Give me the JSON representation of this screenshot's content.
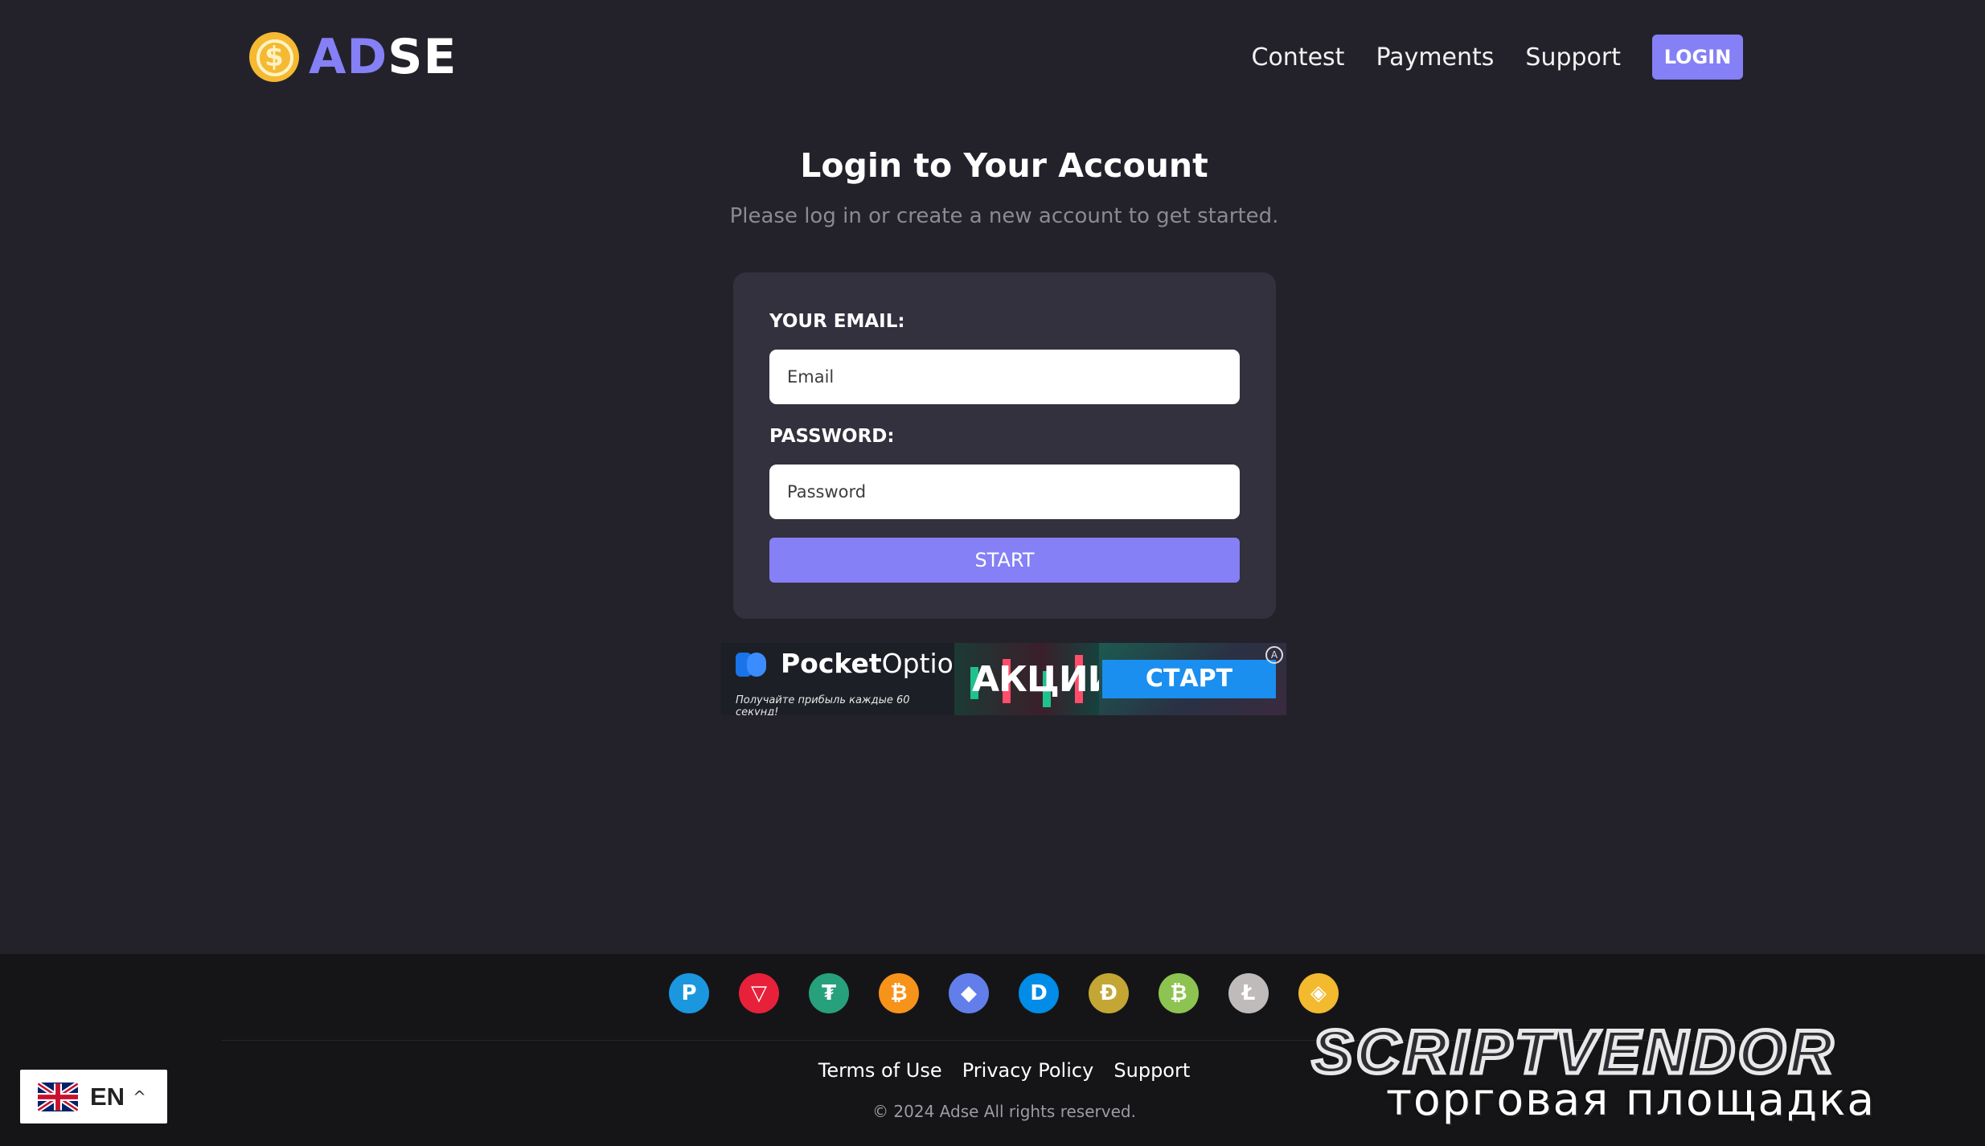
{
  "header": {
    "logo_coin_symbol": "$",
    "logo_part1": "AD",
    "logo_part2": "SE",
    "nav": [
      "Contest",
      "Payments",
      "Support"
    ],
    "login_label": "LOGIN",
    "accent_color": "#8580f5"
  },
  "page": {
    "title": "Login to Your Account",
    "subtitle": "Please log in or create a new account to get started."
  },
  "form": {
    "email_label": "YOUR EMAIL:",
    "email_placeholder": "Email",
    "password_label": "PASSWORD:",
    "password_placeholder": "Password",
    "submit_label": "START"
  },
  "ad": {
    "brand_bold": "Pocket",
    "brand_light": "Option",
    "tagline": "Получайте прибыль каждые 60 секунд!",
    "promo": "АКЦИИ",
    "cta": "СТАРТ"
  },
  "footer": {
    "payment_icons": [
      {
        "name": "payeer-icon",
        "glyph": "P",
        "color": "#1b97e0"
      },
      {
        "name": "tron-icon",
        "glyph": "▽",
        "color": "#e8213a"
      },
      {
        "name": "tether-icon",
        "glyph": "₮",
        "color": "#26a17b"
      },
      {
        "name": "bitcoin-icon",
        "glyph": "₿",
        "color": "#f7931a"
      },
      {
        "name": "ethereum-icon",
        "glyph": "◆",
        "color": "#627eea"
      },
      {
        "name": "dash-icon",
        "glyph": "D",
        "color": "#008ce7"
      },
      {
        "name": "dogecoin-icon",
        "glyph": "Ð",
        "color": "#c3a634"
      },
      {
        "name": "bitcoin-cash-icon",
        "glyph": "₿",
        "color": "#8dc351"
      },
      {
        "name": "litecoin-icon",
        "glyph": "Ł",
        "color": "#bfbbbb"
      },
      {
        "name": "binance-icon",
        "glyph": "◈",
        "color": "#f3ba2f"
      }
    ],
    "links": [
      "Terms of Use",
      "Privacy Policy",
      "Support"
    ],
    "copyright": "© 2024 Adse All rights reserved."
  },
  "language": {
    "code": "EN",
    "chevron": "^"
  },
  "watermark": {
    "title": "SCRIPTVENDOR",
    "subtitle": "торговая площадка"
  }
}
